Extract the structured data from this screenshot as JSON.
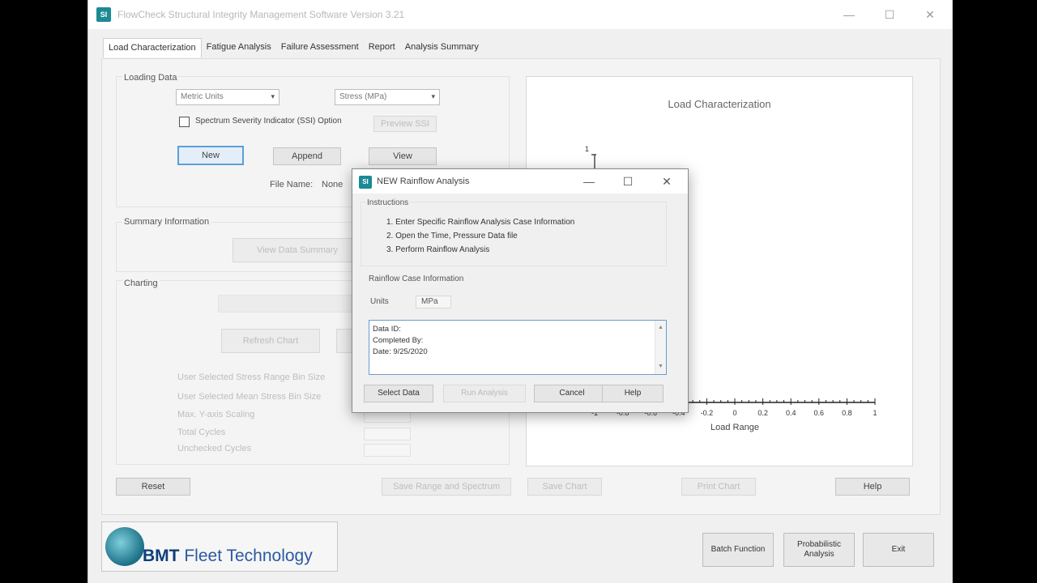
{
  "window": {
    "icon": "app-logo-icon",
    "title": "FlowCheck Structural Integrity Management Software Version 3.21",
    "minimize": "—",
    "maximize": "☐",
    "close": "✕"
  },
  "tabs": [
    {
      "label": "Load Characterization",
      "active": true
    },
    {
      "label": "Fatigue Analysis",
      "active": false
    },
    {
      "label": "Failure Assessment",
      "active": false
    },
    {
      "label": "Report",
      "active": false
    },
    {
      "label": "Analysis Summary",
      "active": false
    }
  ],
  "loading_data": {
    "label": "Loading Data",
    "units_select": "Metric Units",
    "stress_select": "Stress (MPa)",
    "ssi_checkbox": "Spectrum Severity Indicator (SSI) Option",
    "preview_ssi": "Preview SSI",
    "new_button": "New",
    "append_button": "Append",
    "view_button": "View",
    "file_name_label": "File Name:",
    "file_name_value": "None"
  },
  "summary": {
    "label": "Summary Information",
    "view_data_summary": "View Data Summary"
  },
  "charting": {
    "label": "Charting",
    "refresh_chart": "Refresh Chart",
    "fields": [
      "User Selected Stress Range Bin Size",
      "User Selected Mean Stress Bin Size",
      "Max. Y-axis Scaling",
      "Total Cycles",
      "Unchecked Cycles"
    ]
  },
  "chart": {
    "title": "Load Characterization",
    "xlabel": "Load Range",
    "x_ticks": [
      "-1",
      "-0.8",
      "-0.6",
      "-0.4",
      "-0.2",
      "0",
      "0.2",
      "0.4",
      "0.6",
      "0.8",
      "1"
    ],
    "y_tick_top": "1"
  },
  "bottom_buttons": {
    "reset": "Reset",
    "save_range": "Save Range and Spectrum",
    "save_chart": "Save Chart",
    "print_chart": "Print Chart",
    "help": "Help"
  },
  "logo": {
    "brand": "BMT",
    "name": "Fleet Technology"
  },
  "right_buttons": {
    "batch": "Batch Function",
    "probabilistic": "Probabilistic Analysis",
    "exit": "Exit"
  },
  "dialog": {
    "title": "NEW Rainflow Analysis",
    "instructions_label": "Instructions",
    "instructions": [
      "1. Enter Specific Rainflow Analysis Case Information",
      "2. Open the Time, Pressure Data file",
      "3. Perform Rainflow Analysis"
    ],
    "case_info_label": "Rainflow Case Information",
    "units_label": "Units",
    "units_value": "MPa",
    "text_lines": [
      "Data ID:",
      "Completed By:",
      "Date: 9/25/2020"
    ],
    "select_data": "Select Data",
    "run_analysis": "Run Analysis",
    "cancel": "Cancel",
    "help": "Help"
  }
}
